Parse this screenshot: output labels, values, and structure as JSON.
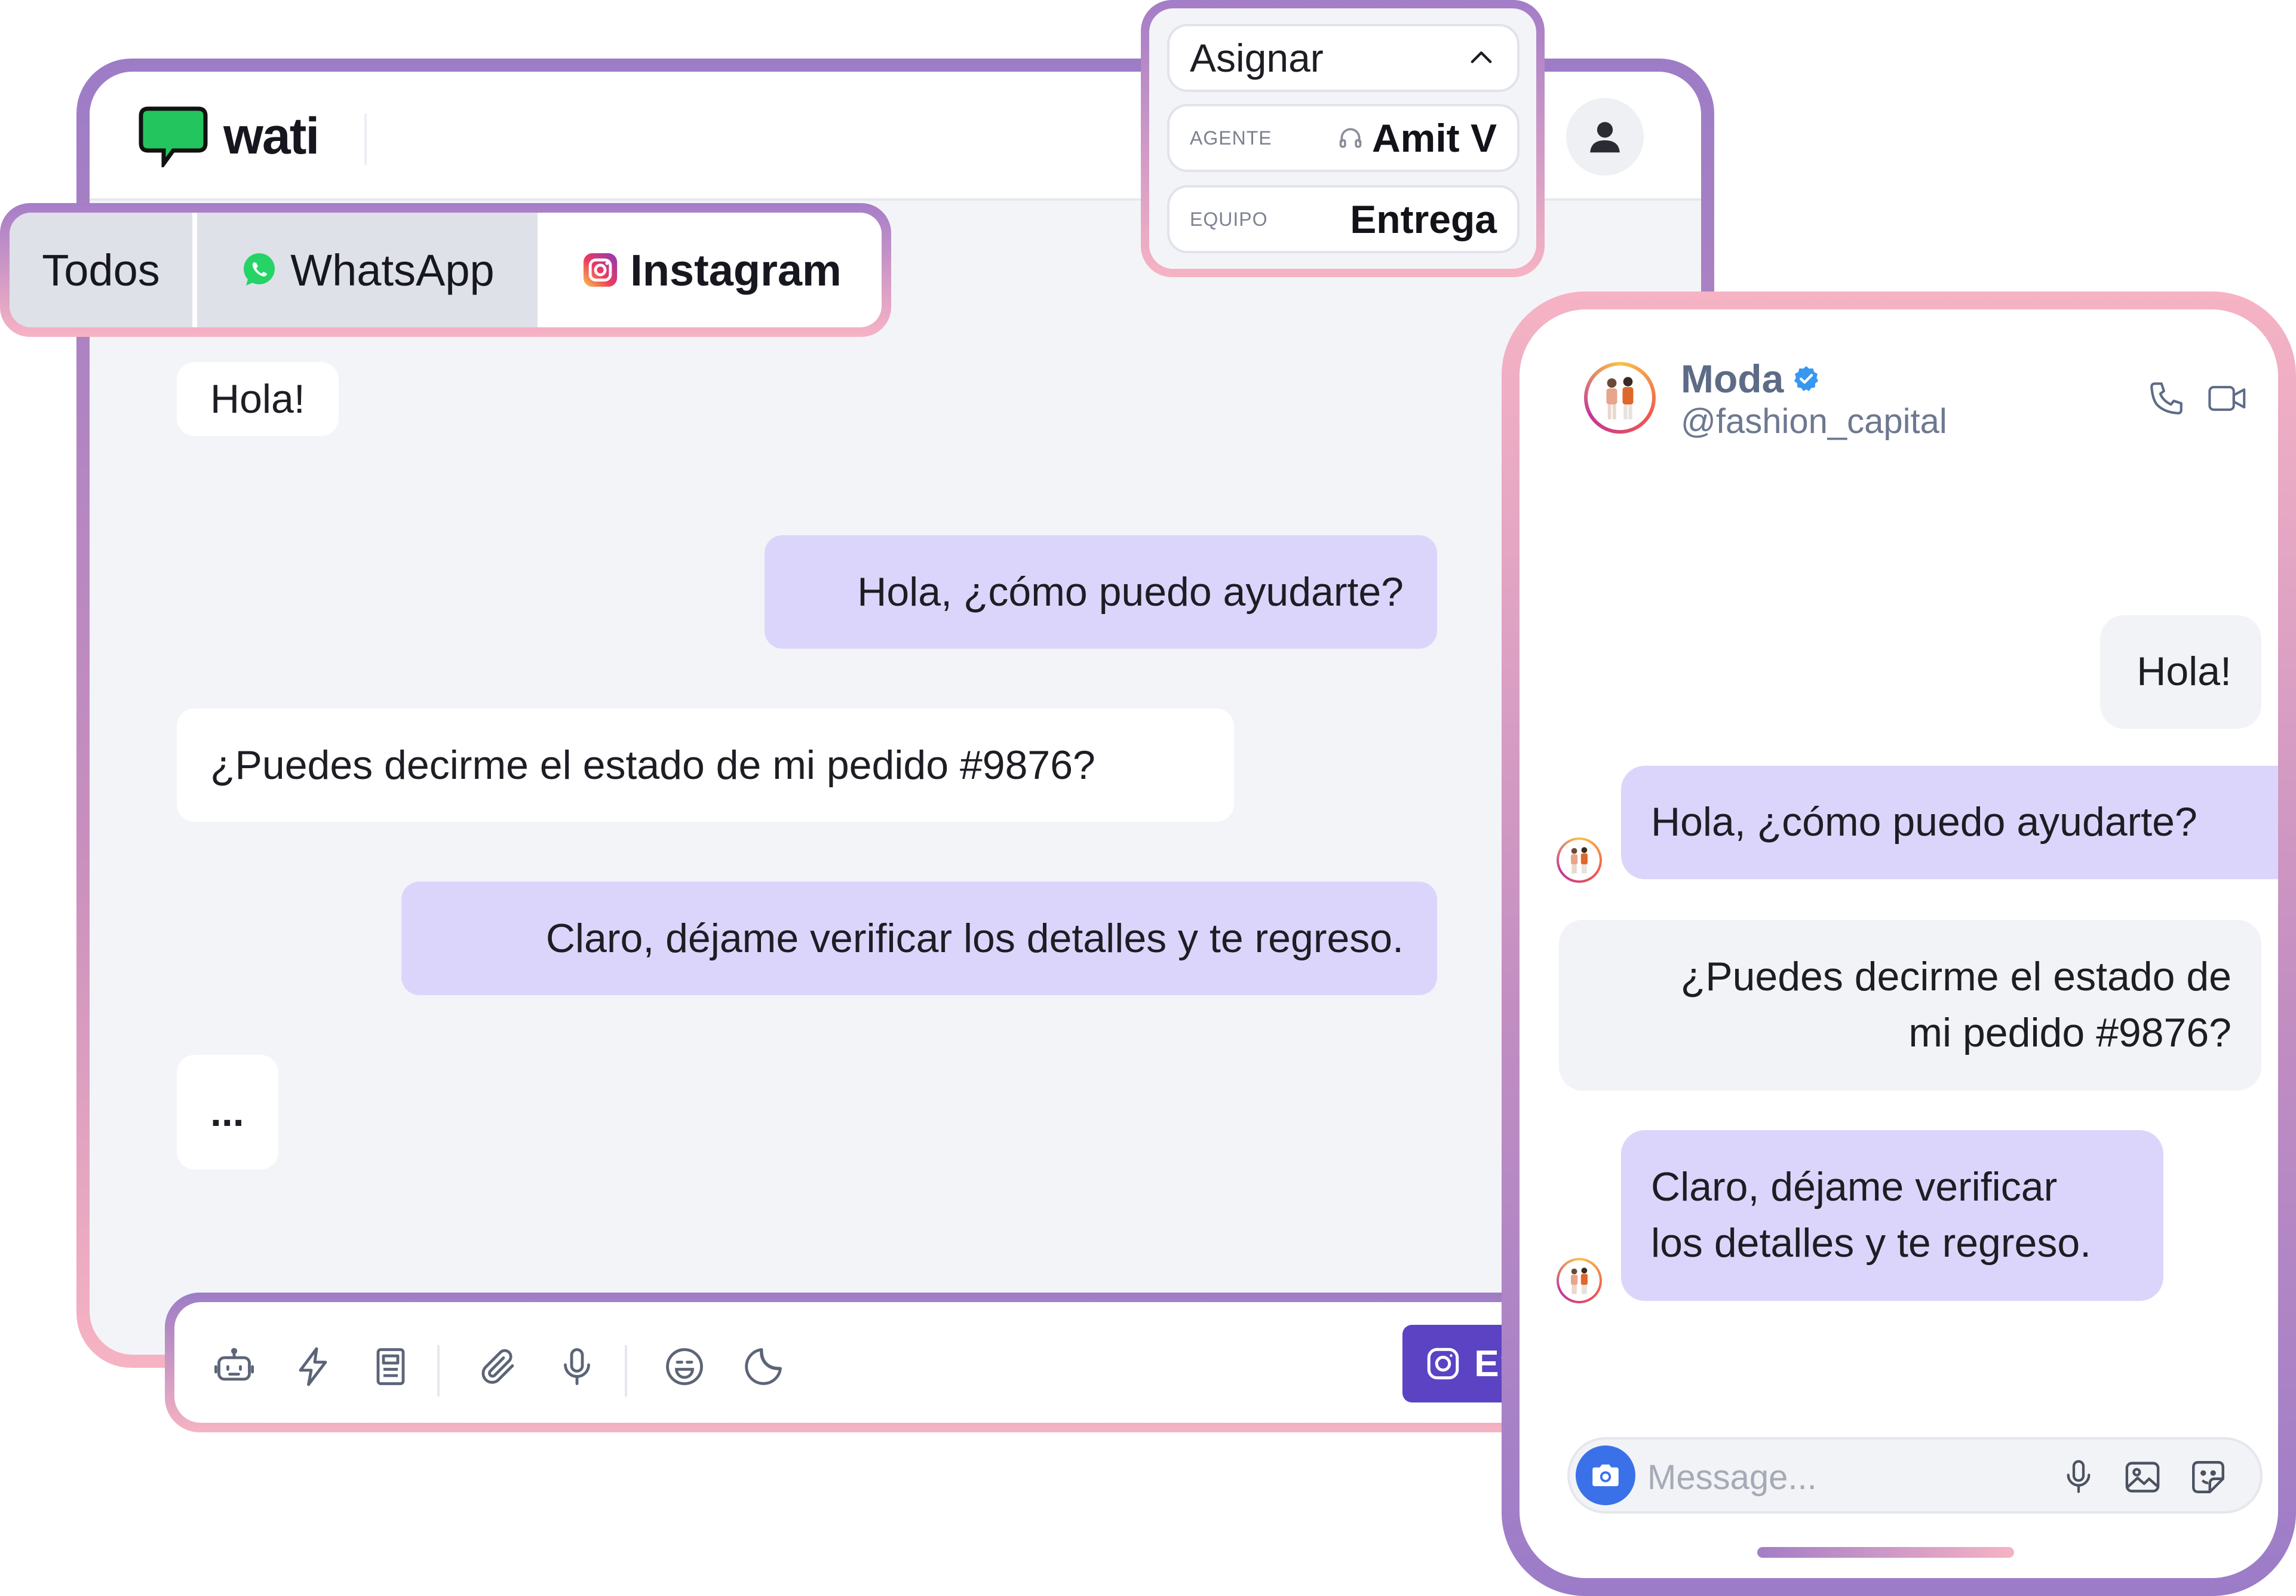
{
  "brand": {
    "name": "wati"
  },
  "tabs": [
    {
      "label": "Todos"
    },
    {
      "label": "WhatsApp"
    },
    {
      "label": "Instagram"
    }
  ],
  "chat": {
    "messages": [
      {
        "direction": "in",
        "text": "Hola!"
      },
      {
        "direction": "out",
        "text": "Hola, ¿cómo puedo ayudarte?"
      },
      {
        "direction": "in",
        "text": "¿Puedes decirme el estado de mi pedido #9876?"
      },
      {
        "direction": "out",
        "text": "Claro, déjame verificar los detalles y te regreso."
      },
      {
        "direction": "in",
        "text": "..."
      }
    ]
  },
  "composer": {
    "icons": [
      "bot-icon",
      "lightning-icon",
      "template-icon",
      "attachment-icon",
      "microphone-icon",
      "emoji-icon",
      "sticker-icon"
    ],
    "send_label": "Enviar"
  },
  "assign": {
    "title": "Asignar",
    "agent_label": "AGENTE",
    "agent_value": "Amit V",
    "team_label": "EQUIPO",
    "team_value": "Entrega"
  },
  "instagram": {
    "name": "Moda",
    "handle": "@fashion_capital",
    "messages": [
      {
        "direction": "in",
        "text": "Hola!"
      },
      {
        "direction": "out",
        "text": "Hola, ¿cómo puedo ayudarte?"
      },
      {
        "direction": "in",
        "lines": [
          "¿Puedes decirme el estado de",
          "mi pedido #9876?"
        ]
      },
      {
        "direction": "out",
        "lines": [
          "Claro, déjame verificar",
          "los detalles y te regreso."
        ]
      }
    ],
    "input_placeholder": "Message..."
  },
  "colors": {
    "accent": "#5b43c4",
    "outgoing_bubble": "#dcd5fb",
    "whatsapp_green": "#25d366",
    "wati_green": "#23c55e",
    "frame_purple": "#9d7cc6",
    "frame_pink": "#f6b3c2",
    "verified_blue": "#3897f0"
  }
}
